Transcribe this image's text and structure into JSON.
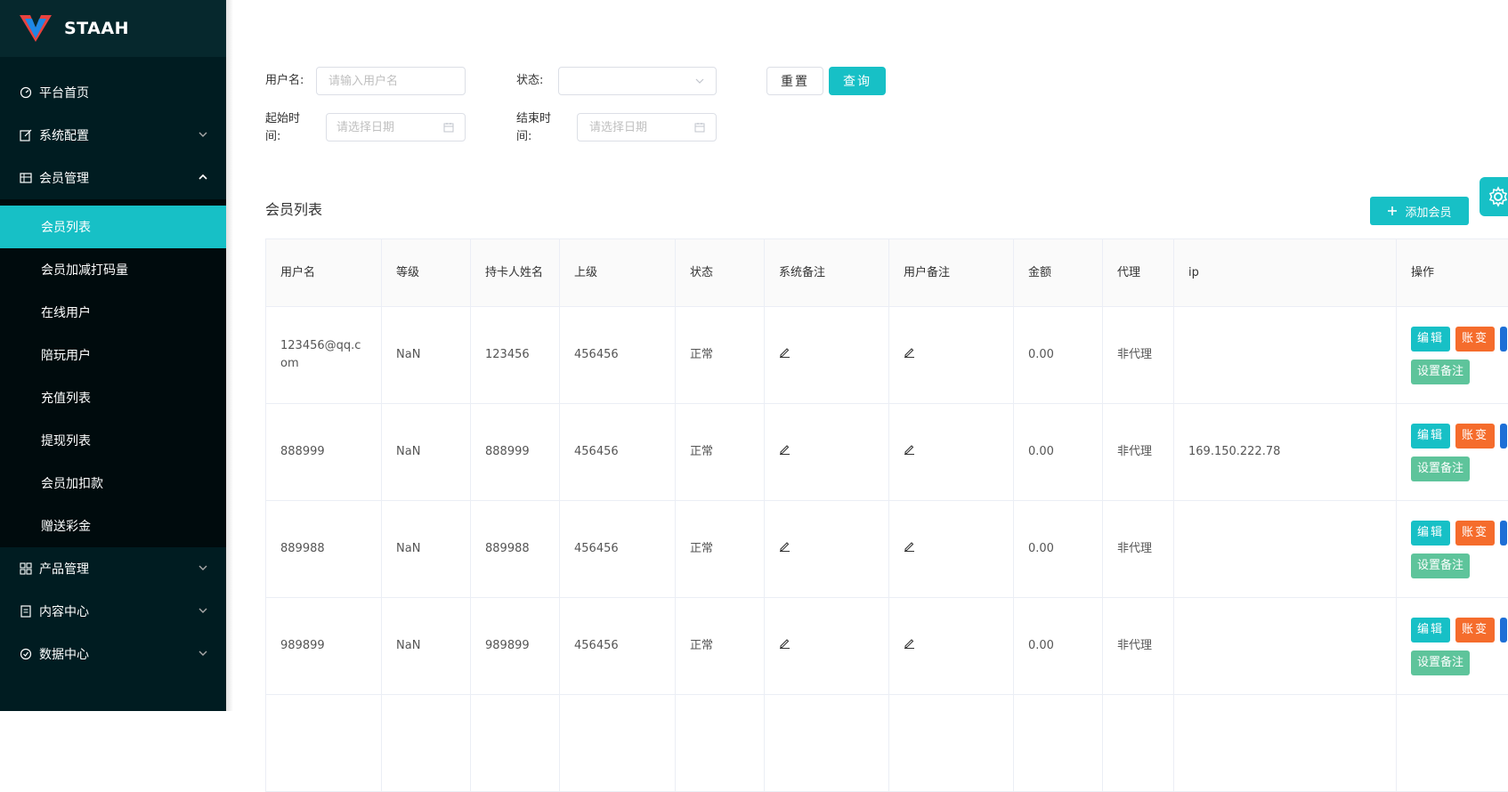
{
  "brand": {
    "name": "STAAH"
  },
  "sidebar": {
    "items": [
      {
        "label": "平台首页",
        "icon": "dashboard-icon"
      },
      {
        "label": "系统配置",
        "icon": "edit-icon"
      },
      {
        "label": "会员管理",
        "icon": "table-icon"
      },
      {
        "label": "产品管理",
        "icon": "grid-icon"
      },
      {
        "label": "内容中心",
        "icon": "document-icon"
      },
      {
        "label": "数据中心",
        "icon": "check-circle-icon"
      }
    ],
    "member_sub": [
      "会员列表",
      "会员加减打码量",
      "在线用户",
      "陪玩用户",
      "充值列表",
      "提现列表",
      "会员加扣款",
      "赠送彩金"
    ]
  },
  "filters": {
    "username_label": "用户名:",
    "username_placeholder": "请输入用户名",
    "status_label": "状态:",
    "start_label_1": "起始时",
    "start_label_2": "间:",
    "start_placeholder": "请选择日期",
    "end_label_1": "结束时",
    "end_label_2": "间:",
    "end_placeholder": "请选择日期",
    "reset_label": "重置",
    "query_label": "查询"
  },
  "list": {
    "title": "会员列表",
    "add_label": "添加会员"
  },
  "table": {
    "headers": [
      "用户名",
      "等级",
      "持卡人姓名",
      "上级",
      "状态",
      "系统备注",
      "用户备注",
      "金额",
      "代理",
      "ip",
      "操作"
    ],
    "rows": [
      {
        "username": "123456@qq.com",
        "level": "NaN",
        "cardholder": "123456",
        "parent": "456456",
        "status": "正常",
        "amount": "0.00",
        "agent": "非代理",
        "ip": ""
      },
      {
        "username": "888999",
        "level": "NaN",
        "cardholder": "888999",
        "parent": "456456",
        "status": "正常",
        "amount": "0.00",
        "agent": "非代理",
        "ip": "169.150.222.78"
      },
      {
        "username": "889988",
        "level": "NaN",
        "cardholder": "889988",
        "parent": "456456",
        "status": "正常",
        "amount": "0.00",
        "agent": "非代理",
        "ip": ""
      },
      {
        "username": "989899",
        "level": "NaN",
        "cardholder": "989899",
        "parent": "456456",
        "status": "正常",
        "amount": "0.00",
        "agent": "非代理",
        "ip": ""
      }
    ],
    "op_edit": "编辑",
    "op_change": "账变",
    "op_note": "设置备注"
  },
  "colors": {
    "accent": "#17c0c6",
    "sidebar_bg": "#001c21",
    "danger": "#f56c2c",
    "note": "#5ec49b"
  }
}
